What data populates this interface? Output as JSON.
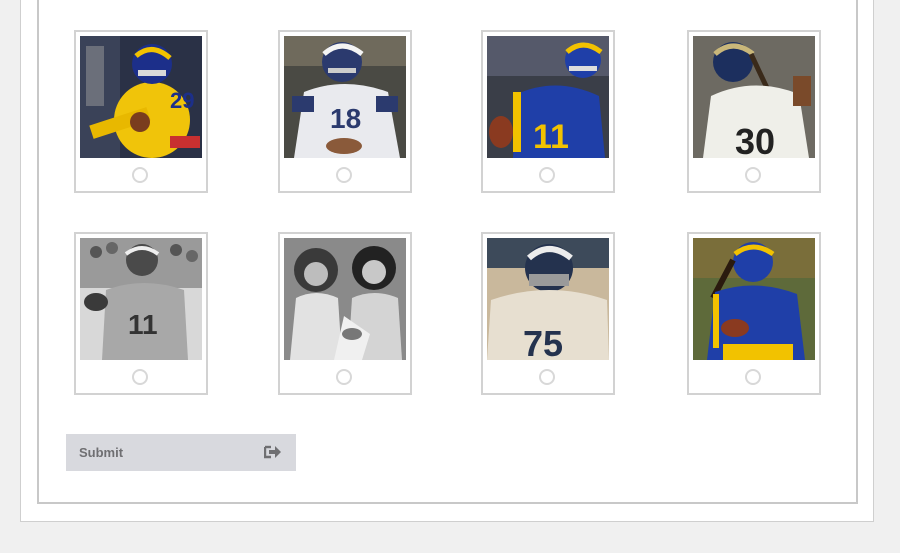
{
  "form": {
    "submit_label": "Submit",
    "submit_icon": "sign-in-icon"
  },
  "options": [
    {
      "id": "player-1",
      "selected": false,
      "photo": "gold-helmet-runner-29",
      "jersey_number": "29"
    },
    {
      "id": "player-2",
      "selected": false,
      "photo": "white-jersey-18",
      "jersey_number": "18"
    },
    {
      "id": "player-3",
      "selected": false,
      "photo": "blue-jersey-11",
      "jersey_number": "11"
    },
    {
      "id": "player-4",
      "selected": false,
      "photo": "white-jersey-30",
      "jersey_number": "30"
    },
    {
      "id": "player-5",
      "selected": false,
      "photo": "bw-quarterback-11",
      "jersey_number": "11"
    },
    {
      "id": "player-6",
      "selected": false,
      "photo": "bw-cheerleaders",
      "jersey_number": ""
    },
    {
      "id": "player-7",
      "selected": false,
      "photo": "white-jersey-75",
      "jersey_number": "75"
    },
    {
      "id": "player-8",
      "selected": false,
      "photo": "blue-jersey-runner",
      "jersey_number": ""
    }
  ],
  "colors": {
    "rams_blue": "#1f3fa8",
    "rams_gold": "#f2c200",
    "card_border": "#d2d2d2",
    "button_bg": "#d8d9de"
  }
}
